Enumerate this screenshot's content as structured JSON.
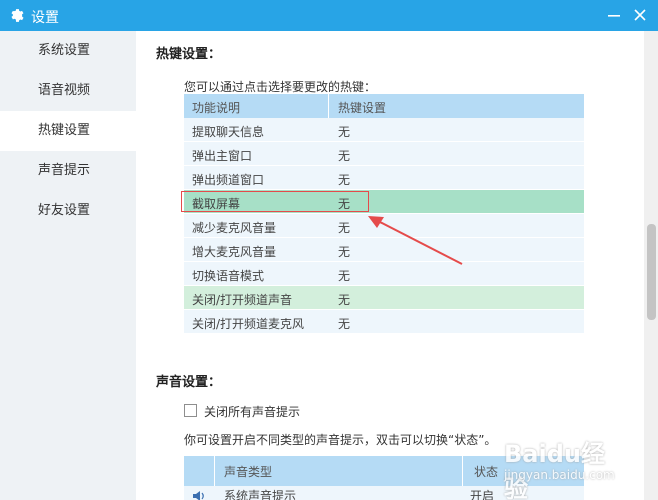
{
  "window": {
    "title": "设置"
  },
  "sidebar": {
    "items": [
      {
        "label": "系统设置"
      },
      {
        "label": "语音视频"
      },
      {
        "label": "热键设置"
      },
      {
        "label": "声音提示"
      },
      {
        "label": "好友设置"
      }
    ],
    "active_index": 2
  },
  "hotkeys": {
    "title": "热键设置：",
    "hint": "您可以通过点击选择要更改的热键：",
    "headers": [
      "功能说明",
      "热键设置"
    ],
    "rows": [
      {
        "name": "提取聊天信息",
        "key": "无"
      },
      {
        "name": "弹出主窗口",
        "key": "无"
      },
      {
        "name": "弹出频道窗口",
        "key": "无"
      },
      {
        "name": "截取屏幕",
        "key": "无"
      },
      {
        "name": "减少麦克风音量",
        "key": "无"
      },
      {
        "name": "增大麦克风音量",
        "key": "无"
      },
      {
        "name": "切换语音模式",
        "key": "无"
      },
      {
        "name": "关闭/打开频道声音",
        "key": "无"
      },
      {
        "name": "关闭/打开频道麦克风",
        "key": "无"
      }
    ]
  },
  "sound": {
    "title": "声音设置：",
    "mute_all_label": "关闭所有声音提示",
    "hint": "你可设置开启不同类型的声音提示，双击可以切换“状态”。",
    "headers": [
      "声音类型",
      "状态"
    ],
    "rows": [
      {
        "type": "系统声音提示",
        "status": "开启"
      }
    ]
  },
  "watermark": {
    "logo": "Baidu经验",
    "url": "jingyan.baidu.com"
  },
  "colors": {
    "titlebar": "#28a4e6",
    "highlight": "#a7e0c7",
    "annotation": "#e54b4b"
  }
}
